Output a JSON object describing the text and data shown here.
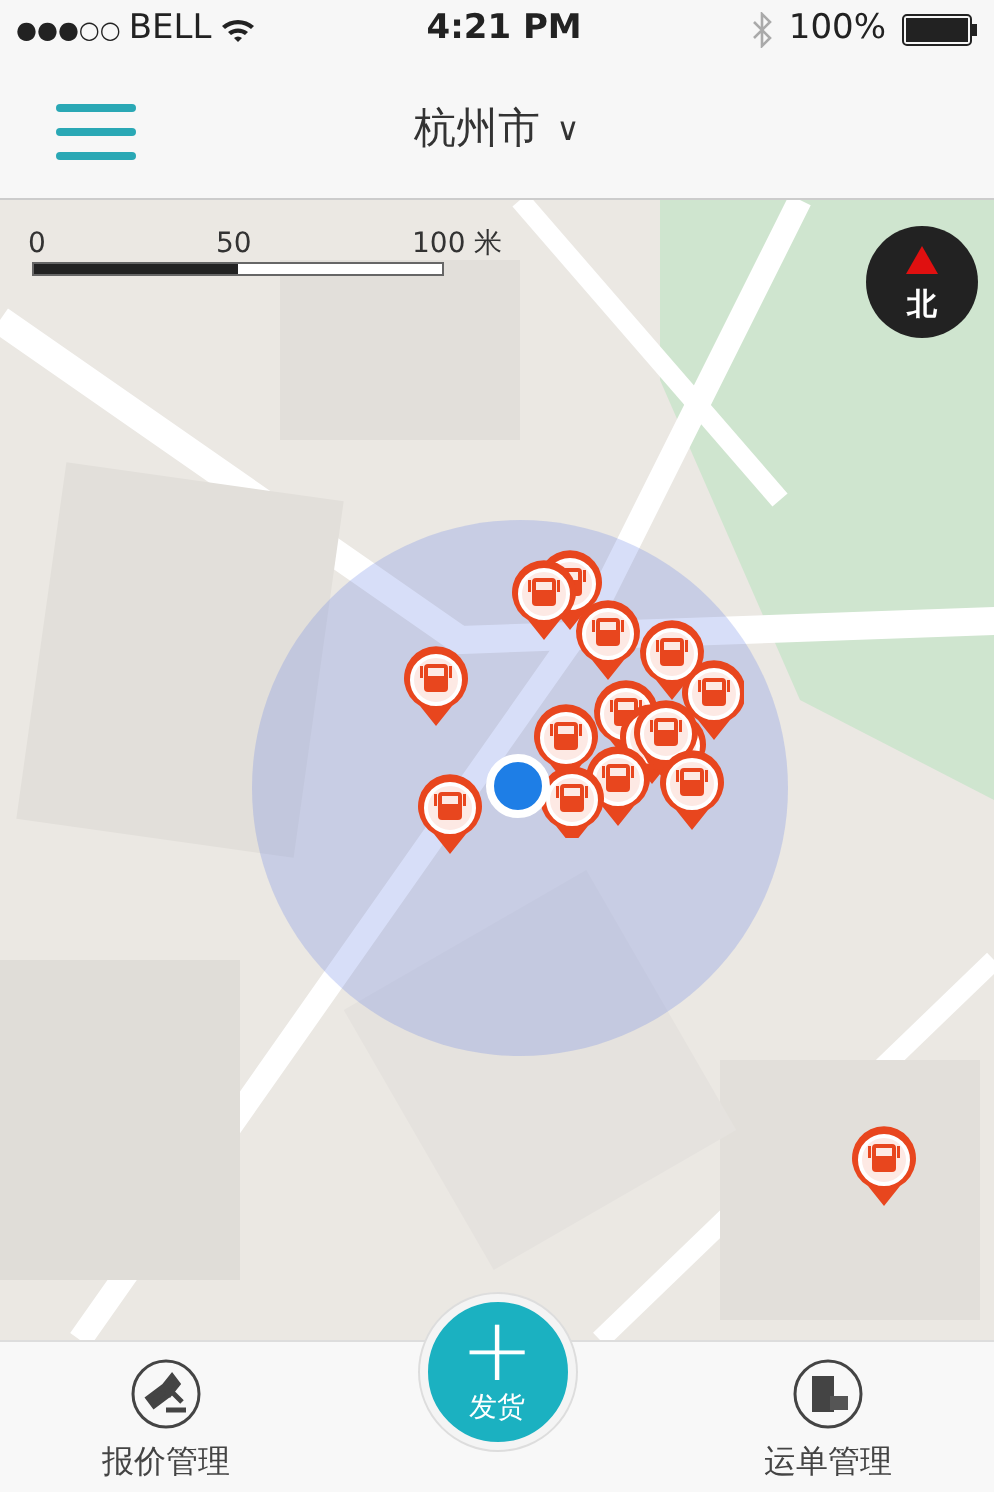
{
  "status_bar": {
    "signal": "●●●○○",
    "carrier": "BELL",
    "time": "4:21 PM",
    "battery": "100%"
  },
  "header": {
    "city": "杭州市",
    "caret": "∨"
  },
  "map": {
    "kind": "picture",
    "scale_labels": [
      "0",
      "50",
      "100 米"
    ],
    "compass": "北"
  },
  "tabs": [
    {
      "kind": "tab",
      "label": "报价管理"
    },
    {
      "kind": "action",
      "icon": "+",
      "label": "发货"
    },
    {
      "kind": "tab",
      "label": "运单管理"
    }
  ]
}
